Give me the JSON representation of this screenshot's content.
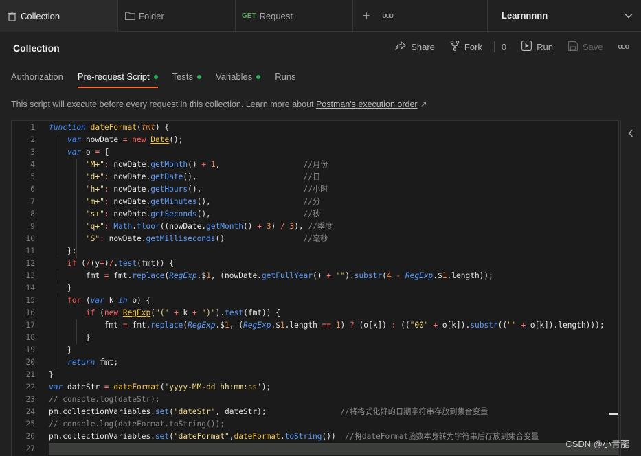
{
  "tabs": [
    {
      "label": "Collection",
      "icon": "trash-icon"
    },
    {
      "label": "Folder",
      "icon": "folder-icon"
    },
    {
      "method": "GET",
      "label": "Request"
    }
  ],
  "tab_actions": {
    "add": "+",
    "more": "ooo"
  },
  "environment": "Learnnnnn",
  "header": {
    "title": "Collection",
    "share": "Share",
    "fork": "Fork",
    "fork_count": "0",
    "run": "Run",
    "save": "Save",
    "more": "ooo"
  },
  "subtabs": [
    {
      "label": "Authorization",
      "dot": false
    },
    {
      "label": "Pre-request Script",
      "dot": true
    },
    {
      "label": "Tests",
      "dot": true
    },
    {
      "label": "Variables",
      "dot": true
    },
    {
      "label": "Runs",
      "dot": false
    }
  ],
  "info": {
    "text": "This script will execute before every request in this collection. Learn more about ",
    "link": "Postman's execution order",
    "arrow": "↗"
  },
  "code_lines": [
    "function dateFormat(fmt) {",
    "    var nowDate = new Date();",
    "    var o = {",
    "        \"M+\": nowDate.getMonth() + 1,                  //月份",
    "        \"d+\": nowDate.getDate(),                       //日",
    "        \"h+\": nowDate.getHours(),                      //小时",
    "        \"m+\": nowDate.getMinutes(),                    //分",
    "        \"s+\": nowDate.getSeconds(),                    //秒",
    "        \"q+\": Math.floor((nowDate.getMonth() + 3) / 3), //季度",
    "        \"S\": nowDate.getMilliseconds()                 //毫秒",
    "    };",
    "    if (/(y+)/.test(fmt)) {",
    "        fmt = fmt.replace(RegExp.$1, (nowDate.getFullYear() + \"\").substr(4 - RegExp.$1.length));",
    "    }",
    "    for (var k in o) {",
    "        if (new RegExp(\"(\" + k + \")\").test(fmt)) {",
    "            fmt = fmt.replace(RegExp.$1, (RegExp.$1.length == 1) ? (o[k]) : ((\"00\" + o[k]).substr((\"\" + o[k]).length)));",
    "        }",
    "    }",
    "    return fmt;",
    "}",
    "var dateStr = dateFormat('yyyy-MM-dd hh:mm:ss');",
    "// console.log(dateStr);",
    "pm.collectionVariables.set(\"dateStr\", dateStr);                //将格式化好的日期字符串存放到集合变量",
    "// console.log(dateFormat.toString());",
    "pm.collectionVariables.set(\"dateFormat\",dateFormat.toString())  //将dateFormat函数本身转为字符串后存放到集合变量",
    ""
  ],
  "watermark": "CSDN @小青龍"
}
